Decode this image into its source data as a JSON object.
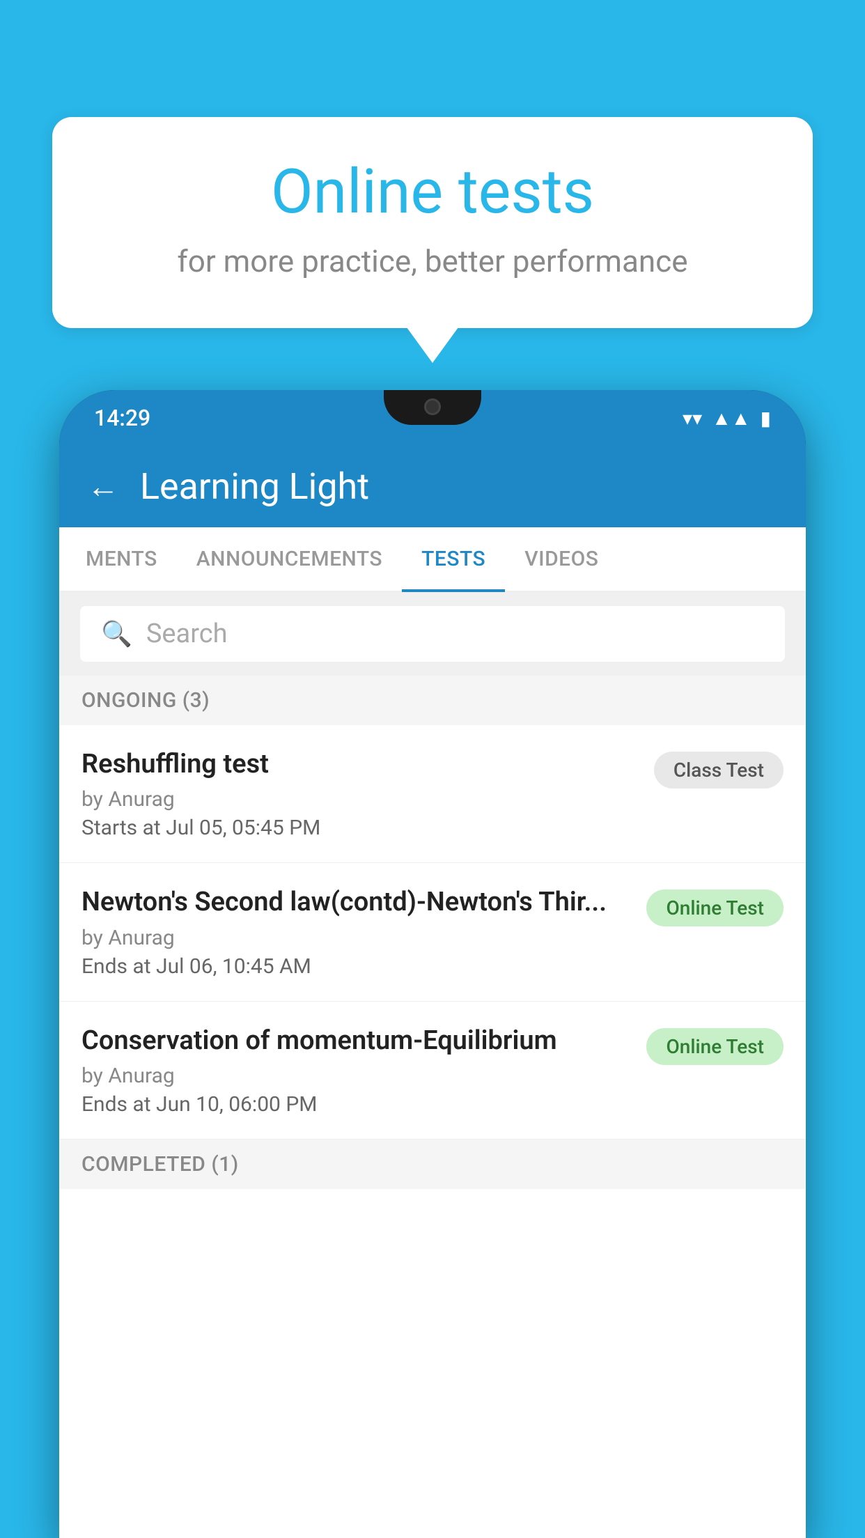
{
  "background": {
    "color": "#29B6E8"
  },
  "speech_bubble": {
    "title": "Online tests",
    "subtitle": "for more practice, better performance"
  },
  "phone": {
    "status_bar": {
      "time": "14:29",
      "wifi": "▼",
      "signal": "▲",
      "battery": "▐"
    },
    "app_header": {
      "back_label": "←",
      "title": "Learning Light"
    },
    "tabs": [
      {
        "label": "MENTS",
        "active": false
      },
      {
        "label": "ANNOUNCEMENTS",
        "active": false
      },
      {
        "label": "TESTS",
        "active": true
      },
      {
        "label": "VIDEOS",
        "active": false
      }
    ],
    "search": {
      "placeholder": "Search"
    },
    "ongoing_section": {
      "header": "ONGOING (3)",
      "tests": [
        {
          "name": "Reshuffling test",
          "author": "by Anurag",
          "date": "Starts at  Jul 05, 05:45 PM",
          "badge": "Class Test",
          "badge_type": "class"
        },
        {
          "name": "Newton's Second law(contd)-Newton's Thir...",
          "author": "by Anurag",
          "date": "Ends at  Jul 06, 10:45 AM",
          "badge": "Online Test",
          "badge_type": "online"
        },
        {
          "name": "Conservation of momentum-Equilibrium",
          "author": "by Anurag",
          "date": "Ends at  Jun 10, 06:00 PM",
          "badge": "Online Test",
          "badge_type": "online"
        }
      ]
    },
    "completed_section": {
      "header": "COMPLETED (1)"
    }
  }
}
